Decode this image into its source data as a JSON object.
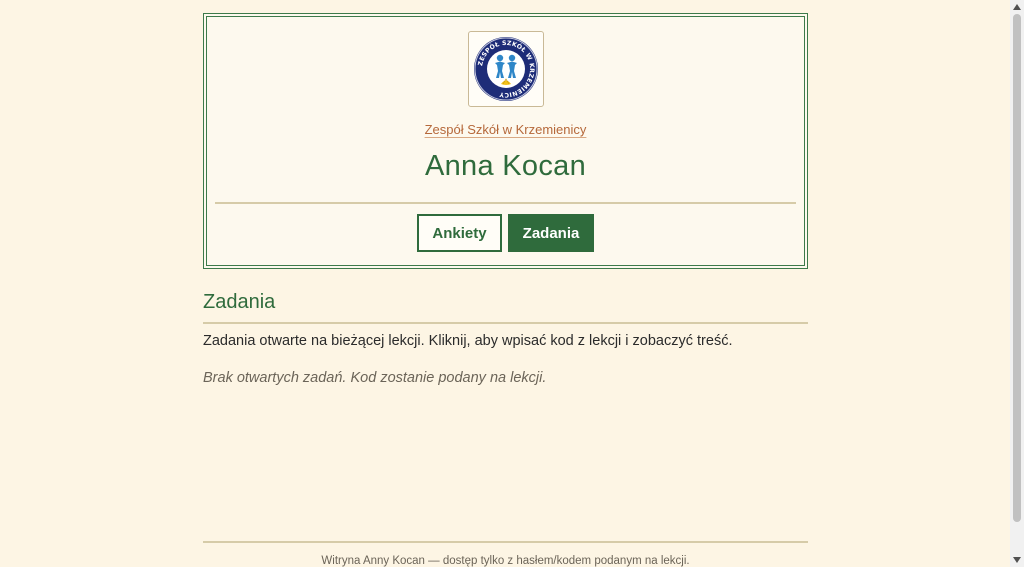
{
  "header": {
    "logo_ring_text": "ZESPÓŁ SZKÓŁ W KRZEMIENICY",
    "school_name": "Zespół Szkół w Krzemienicy",
    "person_name": "Anna Kocan",
    "nav": [
      {
        "label": "Ankiety",
        "active": false
      },
      {
        "label": "Zadania",
        "active": true
      }
    ]
  },
  "section": {
    "title": "Zadania",
    "description": "Zadania otwarte na bieżącej lekcji. Kliknij, aby wpisać kod z lekcji i zobaczyć treść.",
    "empty_message": "Brak otwartych zadań. Kod zostanie podany na lekcji."
  },
  "footer": {
    "text": "Witryna Anny Kocan — dostęp tylko z hasłem/kodem podanym na lekcji."
  },
  "colors": {
    "background": "#fdf5e4",
    "accent_green": "#2f6b3c",
    "link_orange": "#b5683a",
    "rule": "#d6cba8"
  },
  "icons": {
    "logo": "school-emblem",
    "scroll_up": "triangle-up-icon",
    "scroll_down": "triangle-down-icon"
  }
}
